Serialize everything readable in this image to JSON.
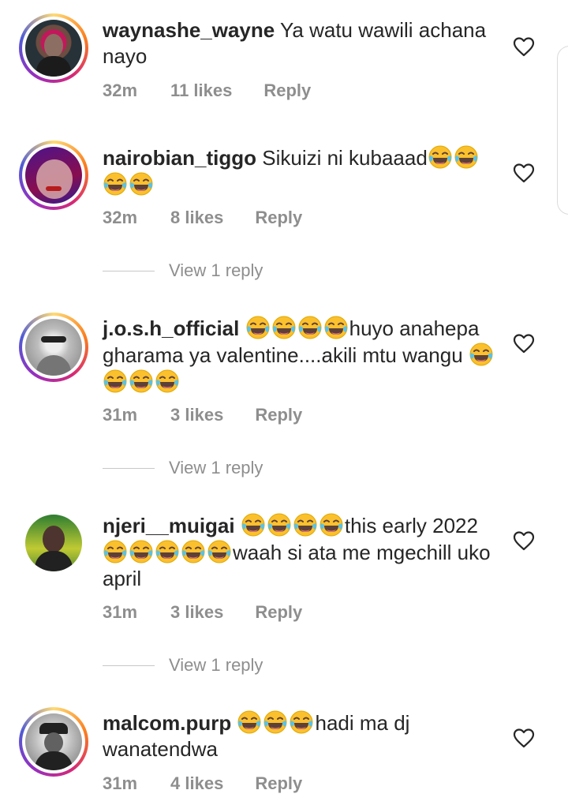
{
  "comments": [
    {
      "username": "waynashe_wayne",
      "text": "Ya watu wawili achana nayo",
      "time": "32m",
      "likes": "11 likes",
      "reply_label": "Reply"
    },
    {
      "username": "nairobian_tiggo",
      "text": "Sikuizi ni kubaaad",
      "time": "32m",
      "likes": "8 likes",
      "reply_label": "Reply",
      "view_replies": "View 1 reply"
    },
    {
      "username": "j.o.s.h_official",
      "text_after_emoji": "huyo anahepa gharama ya valentine....akili mtu wangu",
      "time": "31m",
      "likes": "3 likes",
      "reply_label": "Reply",
      "view_replies": "View 1 reply"
    },
    {
      "username": "njeri__muigai",
      "text_part1": "this early 2022",
      "text_part2": "waah si ata me mgechill uko april",
      "time": "31m",
      "likes": "3 likes",
      "reply_label": "Reply",
      "view_replies": "View 1 reply"
    },
    {
      "username": "malcom.purp",
      "text_after_emoji": "hadi ma dj wanatendwa",
      "time": "31m",
      "likes": "4 likes",
      "reply_label": "Reply"
    }
  ],
  "icons": {
    "like": "heart-outline-icon",
    "emoji": "face-with-tears-of-joy"
  },
  "colors": {
    "text": "#262626",
    "muted": "#8e8e8e",
    "emoji_face": "#f9c74f",
    "story_ring": "#d62976"
  }
}
